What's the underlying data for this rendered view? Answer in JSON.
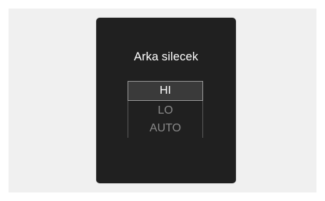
{
  "dialog": {
    "title": "Arka silecek",
    "options": [
      "HI",
      "LO",
      "AUTO"
    ],
    "selected": "HI"
  }
}
